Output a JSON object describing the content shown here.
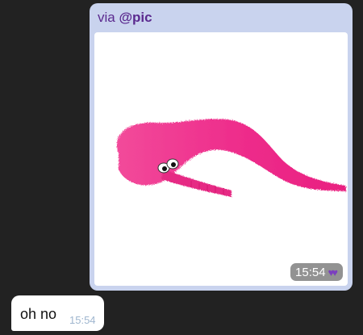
{
  "messages": {
    "outgoing": {
      "via_prefix": "via",
      "via_handle": "@pic",
      "image_description_icon": "fuzzy-pink-worm-toy-image",
      "time": "15:54",
      "status_icon": "double-check-icon",
      "status_glyph": "♥♥"
    },
    "incoming": {
      "text": "oh no",
      "time": "15:54"
    }
  },
  "colors": {
    "background": "#222222",
    "outgoing_bubble": "#c9d3ee",
    "incoming_bubble": "#ffffff",
    "via_text": "#5b2a8f",
    "check_color": "#7b3fbf",
    "incoming_time": "#9fb6cf",
    "worm_pink": "#ee2e8c"
  }
}
